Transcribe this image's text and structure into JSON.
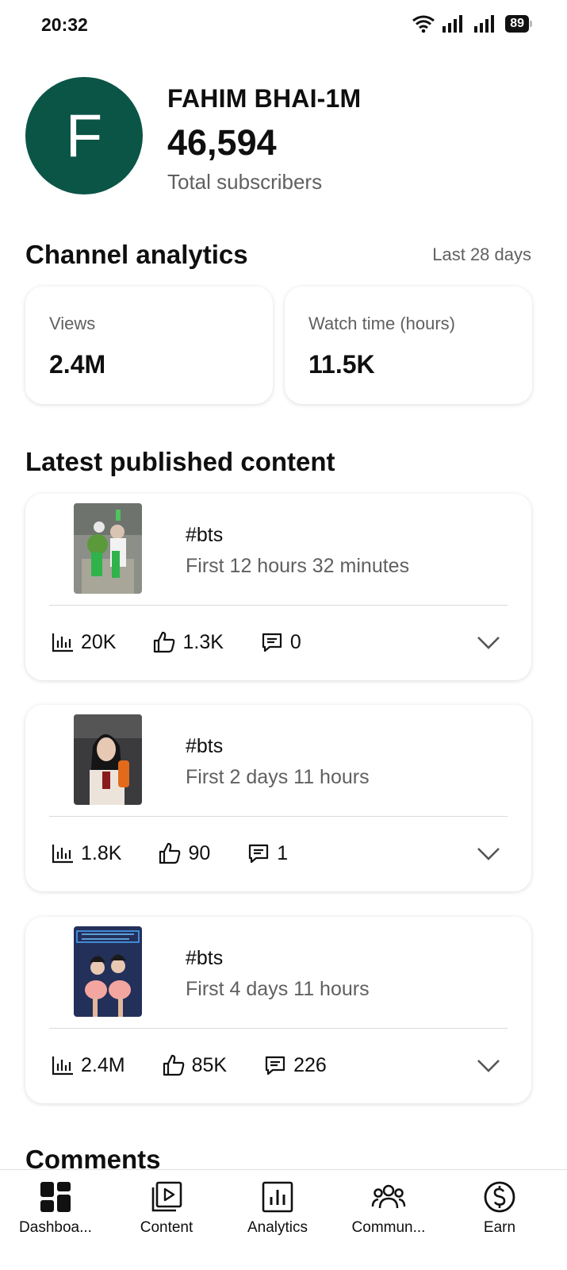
{
  "status": {
    "time": "20:32",
    "battery": "89"
  },
  "channel": {
    "avatar_letter": "F",
    "name": "FAHIM BHAI-1M",
    "subscribers": "46,594",
    "subscribers_label": "Total subscribers"
  },
  "analytics": {
    "title": "Channel analytics",
    "range": "Last 28 days",
    "cards": [
      {
        "label": "Views",
        "value": "2.4M"
      },
      {
        "label": "Watch time (hours)",
        "value": "11.5K"
      }
    ]
  },
  "latest": {
    "title": "Latest published content",
    "items": [
      {
        "title": "#bts",
        "subtitle": "First 12 hours 32 minutes",
        "views": "20K",
        "likes": "1.3K",
        "comments": "0"
      },
      {
        "title": "#bts",
        "subtitle": "First 2 days 11 hours",
        "views": "1.8K",
        "likes": "90",
        "comments": "1"
      },
      {
        "title": "#bts",
        "subtitle": "First 4 days 11 hours",
        "views": "2.4M",
        "likes": "85K",
        "comments": "226"
      }
    ]
  },
  "comments_title": "Comments",
  "nav": [
    {
      "label": "Dashboa...",
      "icon": "dashboard-icon"
    },
    {
      "label": "Content",
      "icon": "content-icon"
    },
    {
      "label": "Analytics",
      "icon": "analytics-icon"
    },
    {
      "label": "Commun...",
      "icon": "community-icon"
    },
    {
      "label": "Earn",
      "icon": "earn-icon"
    }
  ],
  "colors": {
    "avatar": "#0b5547",
    "secondary_text": "#606060"
  }
}
